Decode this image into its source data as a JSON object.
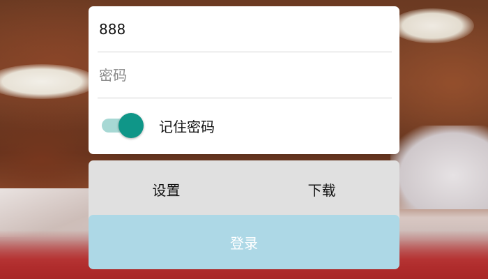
{
  "form": {
    "username_value": "888",
    "password_value": "",
    "password_placeholder": "密码",
    "remember_label": "记住密码",
    "remember_checked": true,
    "switch_thumb_color": "#0f9688",
    "switch_track_color": "#a7d8d4"
  },
  "actions": {
    "settings_label": "设置",
    "download_label": "下载"
  },
  "login": {
    "label": "登录",
    "background_color": "#add8e6"
  }
}
